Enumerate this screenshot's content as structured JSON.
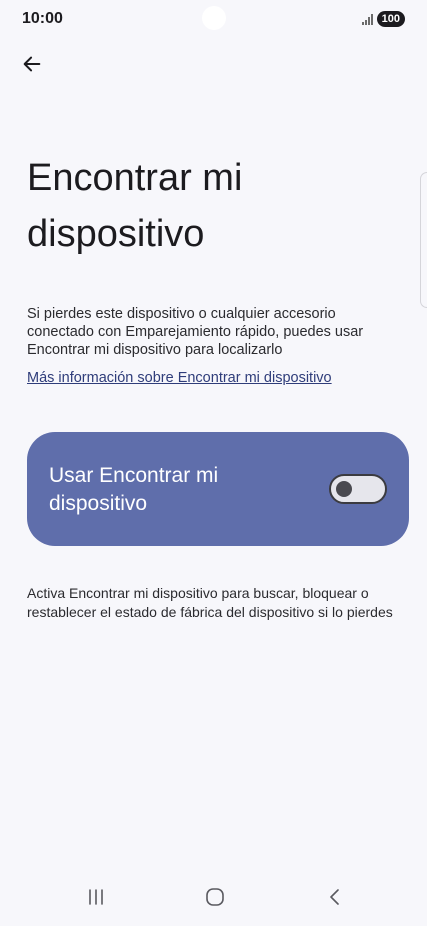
{
  "status_bar": {
    "time": "10:00",
    "battery": "100"
  },
  "header": {
    "back_icon": "arrow-left-icon"
  },
  "title": "Encontrar mi dispositivo",
  "description": "Si pierdes este dispositivo o cualquier accesorio conectado con Emparejamiento rápido, puedes usar Encontrar mi dispositivo para localizarlo",
  "info_link": "Más información sobre Encontrar mi dispositivo",
  "toggle": {
    "label": "Usar Encontrar mi dispositivo",
    "state": "off"
  },
  "footer_text": "Activa Encontrar mi dispositivo para buscar, bloquear o restablecer el estado de fábrica del dispositivo si lo pierdes",
  "nav_bar": {
    "recents_icon": "recents-icon",
    "home_icon": "home-icon",
    "back_icon": "nav-back-icon"
  },
  "colors": {
    "background": "#f7f7fb",
    "card": "#5f6eab",
    "link": "#2f3d7a"
  }
}
